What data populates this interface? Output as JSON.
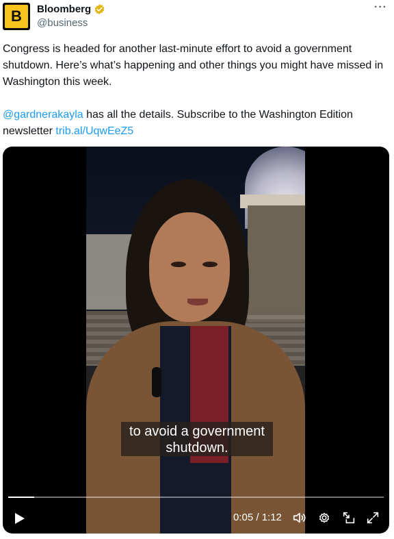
{
  "account": {
    "avatar_letter": "B",
    "display_name": "Bloomberg",
    "handle": "@business",
    "verified_color": "#f9c41d"
  },
  "tweet": {
    "paragraph1": "Congress is headed for another last-minute effort to avoid a government shutdown. Here’s what’s happening and other things you might have missed in Washington this week.",
    "mention": "@gardnerakayla",
    "paragraph2_mid": " has all the details. Subscribe to the Washington Edition newsletter ",
    "link": "trib.al/UqwEeZ5"
  },
  "video": {
    "caption_line1": "to avoid a government",
    "caption_line2": "shutdown.",
    "time_display": "0:05 / 1:12",
    "progress_fraction": 0.069
  },
  "icons": [
    "verified-badge-icon",
    "more-options-icon",
    "play-icon",
    "volume-icon",
    "settings-gear-icon",
    "picture-in-picture-icon",
    "fullscreen-icon"
  ],
  "colors": {
    "link": "#1d9bf0",
    "secondary_text": "#536471",
    "brand_yellow": "#f9c41d"
  }
}
